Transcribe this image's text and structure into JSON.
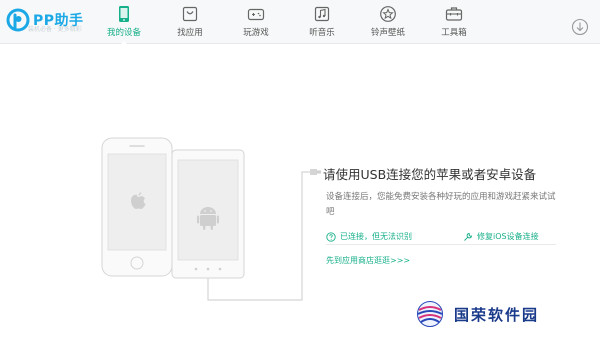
{
  "app": {
    "logo_text": "PP助手",
    "logo_subtitle": "装机必备 · 更多精彩"
  },
  "nav": {
    "items": [
      {
        "label": "我的设备",
        "icon": "phone-icon",
        "active": true
      },
      {
        "label": "找应用",
        "icon": "app-bag-icon",
        "active": false
      },
      {
        "label": "玩游戏",
        "icon": "gamepad-icon",
        "active": false
      },
      {
        "label": "听音乐",
        "icon": "music-note-icon",
        "active": false
      },
      {
        "label": "铃声壁纸",
        "icon": "star-icon",
        "active": false
      },
      {
        "label": "工具箱",
        "icon": "toolbox-icon",
        "active": false
      }
    ],
    "download_icon": "download-icon"
  },
  "main": {
    "title": "请使用USB连接您的苹果或者安卓设备",
    "description": "设备连接后，您能免费安装各种好玩的应用和游戏赶紧来试试吧",
    "status_connected": "已连接，但无法识别",
    "status_repair": "修复iOS设备连接",
    "store_link": "先到应用商店逛逛>>>"
  },
  "watermark": {
    "text": "国荣软件园"
  },
  "colors": {
    "accent": "#18b08a",
    "brand": "#1aa8e6",
    "watermark": "#1a3a8a"
  }
}
